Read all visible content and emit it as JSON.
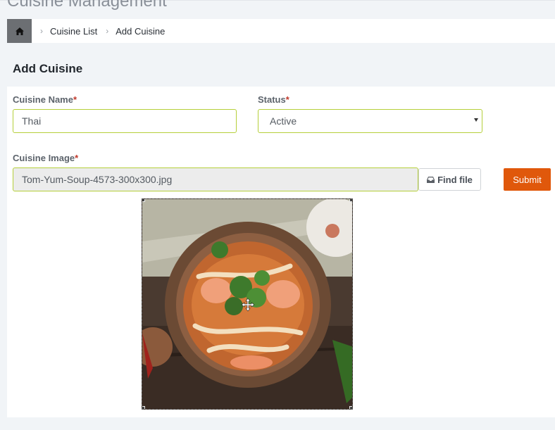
{
  "header": {
    "page_title": "Cuisine Management"
  },
  "breadcrumb": {
    "home_icon": "home-icon",
    "items": [
      "Cuisine List",
      "Add Cuisine"
    ]
  },
  "card": {
    "title": "Add Cuisine"
  },
  "form": {
    "cuisine_name": {
      "label": "Cuisine Name",
      "required_mark": "*",
      "value": "Thai"
    },
    "status": {
      "label": "Status",
      "required_mark": "*",
      "value": "Active"
    },
    "cuisine_image": {
      "label": "Cuisine Image",
      "required_mark": "*",
      "value": "Tom-Yum-Soup-4573-300x300.jpg"
    },
    "find_file_label": "Find file",
    "submit_label": "Submit"
  },
  "colors": {
    "accent": "#e0580b",
    "input_border": "#b5cf3a",
    "required": "#c0392b"
  }
}
